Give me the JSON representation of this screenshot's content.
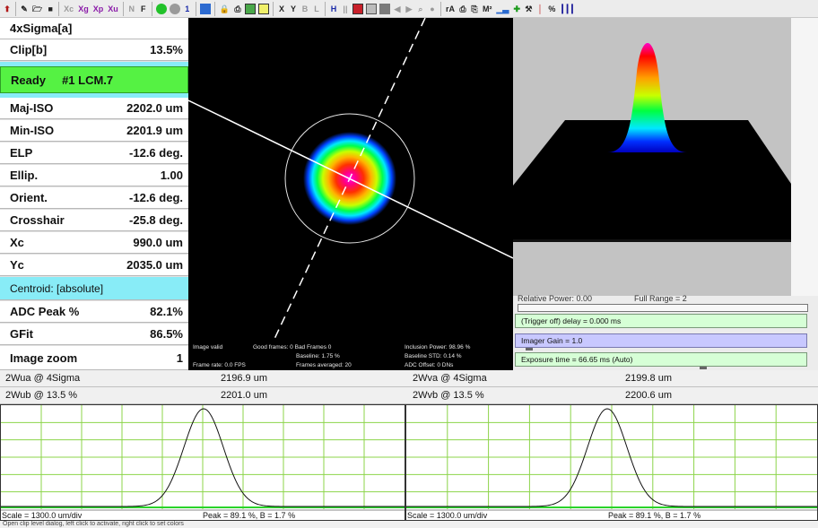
{
  "toolbar": {
    "items": [
      "Xc",
      "Xg",
      "Xp",
      "Xu",
      "N",
      "F",
      "1",
      "X",
      "Y",
      "B",
      "L",
      "H",
      "rA",
      "M²",
      "%"
    ]
  },
  "metrics": [
    {
      "label": "4xSigma[a]",
      "value": "",
      "style": "plain"
    },
    {
      "label": "Clip[b]",
      "value": "13.5%",
      "style": "plain"
    },
    {
      "label": "",
      "value": "",
      "style": "cyan"
    },
    {
      "label": "Ready     #1 LCM.7",
      "value": "",
      "style": "green"
    },
    {
      "label": "",
      "value": "",
      "style": "cyan"
    },
    {
      "label": "Maj-ISO",
      "value": "2202.0 um",
      "style": "plain"
    },
    {
      "label": "Min-ISO",
      "value": "2201.9 um",
      "style": "plain"
    },
    {
      "label": "ELP",
      "value": "-12.6 deg.",
      "style": "plain"
    },
    {
      "label": "Ellip.",
      "value": "1.00",
      "style": "plain"
    },
    {
      "label": "Orient.",
      "value": "-12.6 deg.",
      "style": "plain"
    },
    {
      "label": "Crosshair",
      "value": "-25.8 deg.",
      "style": "plain"
    },
    {
      "label": "Xc",
      "value": "990.0 um",
      "style": "plain"
    },
    {
      "label": "Yc",
      "value": "2035.0 um",
      "style": "plain"
    },
    {
      "label": "Centroid: [absolute]",
      "value": "",
      "style": "cyan"
    },
    {
      "label": "ADC Peak %",
      "value": "82.1%",
      "style": "plain"
    },
    {
      "label": "GFit",
      "value": "86.5%",
      "style": "plain"
    },
    {
      "label": "Image zoom",
      "value": "1",
      "style": "plain"
    }
  ],
  "beam_info": {
    "image_valid": "Image valid",
    "frame_rate": "Frame rate: 0.0 FPS",
    "frames": "Good frames: 0 Bad Frames 0",
    "baseline": "Baseline: 1.75 %",
    "frames_averaged": "Frames averaged: 20",
    "inclusion_power": "Inclusion Power: 98.96 %",
    "baseline_std": "Baseline STD: 0.14 %",
    "adc_offset": "ADC Offset: 0 DNs"
  },
  "controls": {
    "relative_power": "Relative Power: 0.00",
    "full_range": "Full Range = 2",
    "trigger": "(Trigger off) delay = 0.000 ms",
    "gain": "Imager Gain = 1.0",
    "exposure": "Exposure time = 66.65 ms (Auto)"
  },
  "profiles": {
    "left": {
      "row1_label": "2Wua @ 4Sigma",
      "row1_value": "2196.9 um",
      "row2_label": "2Wub @ 13.5 %",
      "row2_value": "2201.0 um",
      "scale": "Scale = 1300.0 um/div",
      "peak": "Peak = 89.1 %,  B = 1.7 %"
    },
    "right": {
      "row1_label": "2Wva @ 4Sigma",
      "row1_value": "2199.8 um",
      "row2_label": "2Wvb @ 13.5 %",
      "row2_value": "2200.6 um",
      "scale": "Scale = 1300.0 um/div",
      "peak": "Peak = 89.1 %,  B = 1.7 %"
    }
  },
  "status": "Open clip level dialog, left click to activate, right click to set colors",
  "colors": {
    "ready": "#55f243",
    "cyan": "#88ecf7",
    "gain": "#c8c8ff",
    "control": "#d6ffd6",
    "grid": "#8cd44a",
    "baseline": "#2bd42b"
  }
}
